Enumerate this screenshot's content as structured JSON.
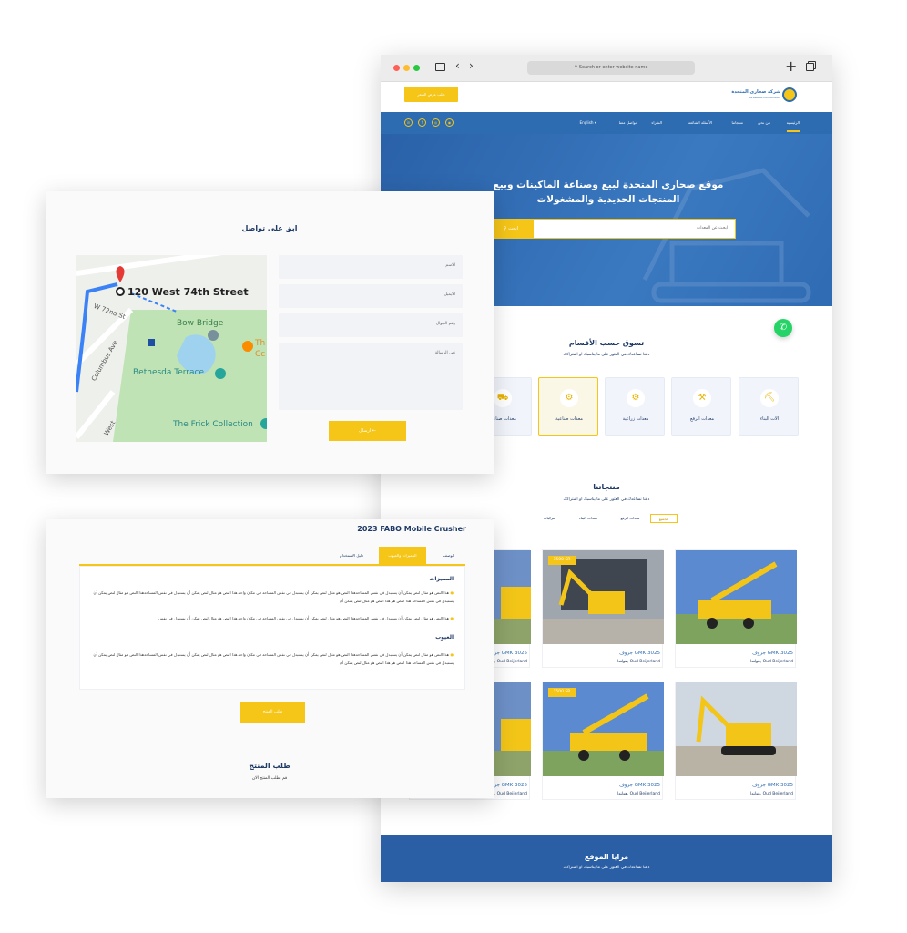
{
  "browser": {
    "url_placeholder": "Search or enter website name",
    "header": {
      "request_button": "طلب عرض السعر",
      "logo_ar": "شركة صحارى المتحدة",
      "logo_en": "SAHARA AL MUTTAHIDAH"
    },
    "nav": {
      "items": [
        "الرئيسية",
        "من نحن",
        "منتجاتنا",
        "الأسئلة الشائعة",
        "الشراء",
        "تواصل معنا"
      ],
      "lang": "English ▾",
      "social": [
        "in",
        "f",
        "◎",
        "◉"
      ]
    },
    "hero": {
      "title": "موقع صحارى المتحدة لبيع وصناعة الماكينات وبيع المنتجات الحديدية والمشغولات",
      "search_placeholder": "ابحث عن المعدات",
      "search_button": "ابحث"
    },
    "categories": {
      "title": "تسوق حسب الأقسام",
      "subtitle": "دعنا نساعدك في العثور على ما يناسبك او اشتراكك",
      "items": [
        "الات البناء",
        "معدات الرفع",
        "معدات زراعية",
        "معدات صناعية",
        "معدات صناعية"
      ]
    },
    "products": {
      "title": "منتجاتنا",
      "subtitle": "دعنا نساعدك في العثور على ما يناسبك او اشتراكك",
      "filters": [
        "الجميع",
        "معدات الرفع",
        "معدات البناء",
        "مركبات"
      ],
      "cards": [
        {
          "title": "جروف GMK 3025",
          "location": "هولندا, Oud Beijerland",
          "price": ""
        },
        {
          "title": "جروف GMK 3025",
          "location": "هولندا, Oud Beijerland",
          "price": "1500 SR"
        },
        {
          "title": "جروف GMK 3025",
          "location": "هولندا, Oud Beijerland",
          "price": ""
        },
        {
          "title": "جروف GMK 3025",
          "location": "هولندا, Oud Beijerland",
          "price": ""
        },
        {
          "title": "جروف GMK 3025",
          "location": "هولندا, Oud Beijerland",
          "price": "1500 SR"
        },
        {
          "title": "جروف GMK 3025",
          "location": "هولندا, Oud Beijerland",
          "price": ""
        }
      ]
    },
    "footer": {
      "title": "مزايا الموقع",
      "subtitle": "دعنا نساعدك في العثور على ما يناسبك او اشتراكك"
    }
  },
  "contact": {
    "title": "ابق على تواصل",
    "map": {
      "address": "120 West 74th Street",
      "labels": [
        "Bow Bridge",
        "Bethesda Terrace",
        "The Frick Collection",
        "W 72nd St",
        "Columbus Ave",
        "West",
        "Th",
        "Cc"
      ]
    },
    "fields": {
      "name": "الاسم",
      "email": "الايميل",
      "phone": "رقم الجوال",
      "message": "نص الرسالة"
    },
    "send_button": "ارسال ←"
  },
  "product": {
    "title": "2023 FABO Mobile Crusher",
    "tabs": [
      "الوصف",
      "المميزات والعيوب",
      "دليل الاستخدام"
    ],
    "pros_title": "المميزات",
    "pros": [
      "هذا النص هو مثال لنص يمكن أن يستبدل في نفس المساحةهذا النص هو مثال لنص يمكن أن يستبدل في نفس المساحة في مكان واحد.هذا النص هو مثال لنص يمكن أن يستبدل في نفس المساحةهذا النص هو مثال لنص يمكن أن يستبدل في نفس المساحة هذا النص هو هذا النص هو مثال لنص يمكن أن",
      "هذا النص هو مثال لنص يمكن أن يستبدل في نفس المساحةهذا النص هو مثال لنص يمكن أن يستبدل في نفس المساحة في مكان واحد.هذا النص هو مثال لنص يمكن أن يستبدل في نفس"
    ],
    "cons_title": "العيوب",
    "cons": [
      "هذا النص هو مثال لنص يمكن أن يستبدل في نفس المساحةهذا النص هو مثال لنص يمكن أن يستبدل في نفس المساحة في مكان واحد.هذا النص هو مثال لنص يمكن أن يستبدل في نفس المساحةهذا النص هو مثال لنص يمكن أن يستبدل في نفس المساحة هذا النص هو هذا النص هو مثال لنص يمكن أن"
    ],
    "request_button": "طلب المنتج",
    "request_title": "طلب المنتج",
    "request_subtitle": "قم بطلب المنتج الان"
  },
  "colors": {
    "primary_blue": "#2d6cb0",
    "accent_yellow": "#f5c518",
    "navy_text": "#1f3a66"
  }
}
